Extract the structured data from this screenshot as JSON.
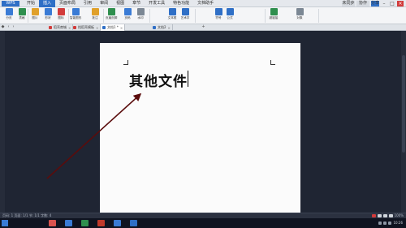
{
  "titlebar": {
    "app_label": "WPS",
    "tabs": [
      "开始",
      "插入",
      "页面布局",
      "引用",
      "审阅",
      "视图",
      "章节",
      "开发工具",
      "特色功能",
      "文档助手"
    ],
    "active_tab_index": 1,
    "right_buttons": [
      "未同步",
      "协作",
      "分享"
    ]
  },
  "ribbon": {
    "groups": [
      {
        "label": "分页",
        "icon": "page-break-icon"
      },
      {
        "label": "表格",
        "icon": "table-icon"
      },
      {
        "label": "图片",
        "icon": "picture-icon"
      },
      {
        "label": "形状",
        "icon": "shape-icon"
      },
      {
        "label": "图标",
        "icon": "icon-library-icon"
      },
      {
        "label": "智能图形",
        "icon": "smart-graphic-icon"
      },
      {
        "label": "批注",
        "icon": "comment-icon"
      },
      {
        "label": "页眉页脚",
        "icon": "header-footer-icon"
      },
      {
        "label": "页码",
        "icon": "page-number-icon"
      },
      {
        "label": "水印",
        "icon": "watermark-icon"
      },
      {
        "label": "文本框",
        "icon": "textbox-icon"
      },
      {
        "label": "艺术字",
        "icon": "wordart-icon"
      },
      {
        "label": "符号",
        "icon": "symbol-icon"
      },
      {
        "label": "公式",
        "icon": "formula-icon"
      },
      {
        "label": "超链接",
        "icon": "hyperlink-icon"
      },
      {
        "label": "对象",
        "icon": "object-icon"
      }
    ]
  },
  "tabbar": {
    "tabs": [
      {
        "label": "稻壳商城",
        "color": "#d23b3b"
      },
      {
        "label": "找稻壳模板",
        "color": "#d23b3b"
      },
      {
        "label": "文档1 *",
        "color": "#2f6fc6"
      },
      {
        "label": "文档2",
        "color": "#2f6fc6"
      }
    ],
    "active_index": 2
  },
  "document": {
    "heading": "其他文件"
  },
  "status": {
    "left": "页码: 1  页面: 1/1  节: 1/1  字数: 4",
    "zoom": "100%"
  },
  "taskbar": {
    "apps": [
      "#d9534f",
      "#3a7bd5",
      "#2f8f4e",
      "#c0392b",
      "#3a7bd5",
      "#2f6fc6"
    ],
    "clock": "10:26"
  },
  "colors": {
    "accent": "#2f6fc6",
    "arrow": "#5a0c0c",
    "workspace": "#1f2533"
  }
}
